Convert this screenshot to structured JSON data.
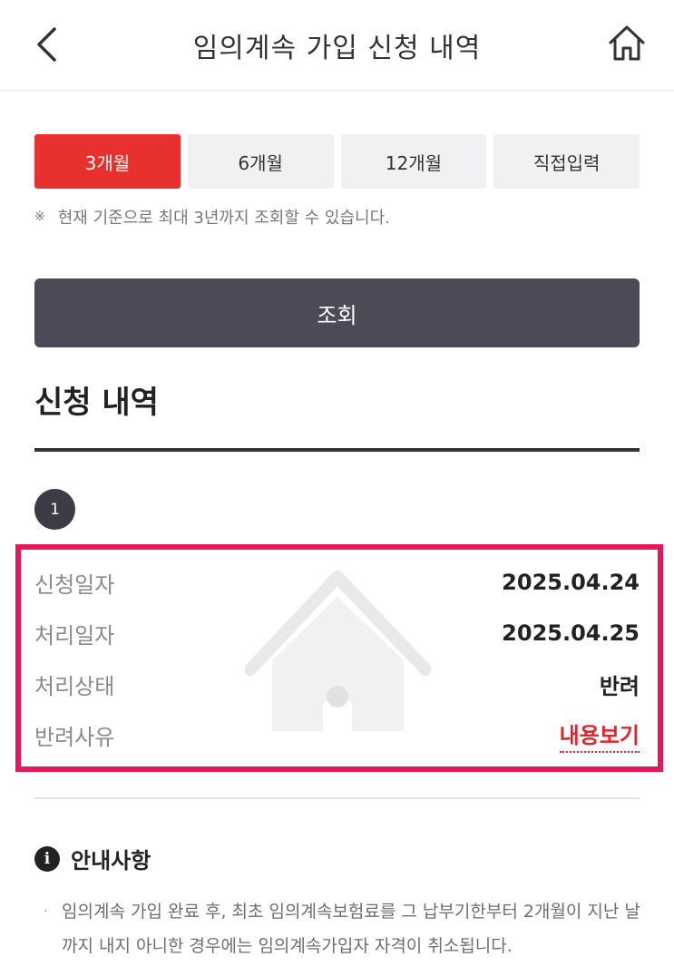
{
  "header": {
    "title": "임의계속 가입 신청 내역",
    "back_icon": "chevron-left-icon",
    "home_icon": "home-icon"
  },
  "period_tabs": [
    {
      "label": "3개월",
      "selected": true
    },
    {
      "label": "6개월",
      "selected": false
    },
    {
      "label": "12개월",
      "selected": false
    },
    {
      "label": "직접입력",
      "selected": false
    }
  ],
  "notice": {
    "mark": "※",
    "text": "현재 기준으로 최대 3년까지 조회할 수 있습니다."
  },
  "search_button": {
    "label": "조회"
  },
  "history": {
    "title": "신청 내역",
    "index": "1",
    "rows": [
      {
        "label": "신청일자",
        "value": "2025.04.24"
      },
      {
        "label": "처리일자",
        "value": "2025.04.25"
      },
      {
        "label": "처리상태",
        "value": "반려"
      },
      {
        "label": "반려사유",
        "value": "내용보기"
      }
    ]
  },
  "guide": {
    "title": "안내사항",
    "bullet": "·",
    "text": "임의계속 가입 완료 후, 최초 임의계속보험료를 그 납부기한부터 2개월이 지난 날까지 내지 아니한 경우에는 임의계속가입자 자격이 취소됩니다."
  },
  "colors": {
    "accent": "#e8312f",
    "dark_button": "#4b4b57",
    "highlight_border": "#e5185c",
    "link": "#e0252b"
  }
}
